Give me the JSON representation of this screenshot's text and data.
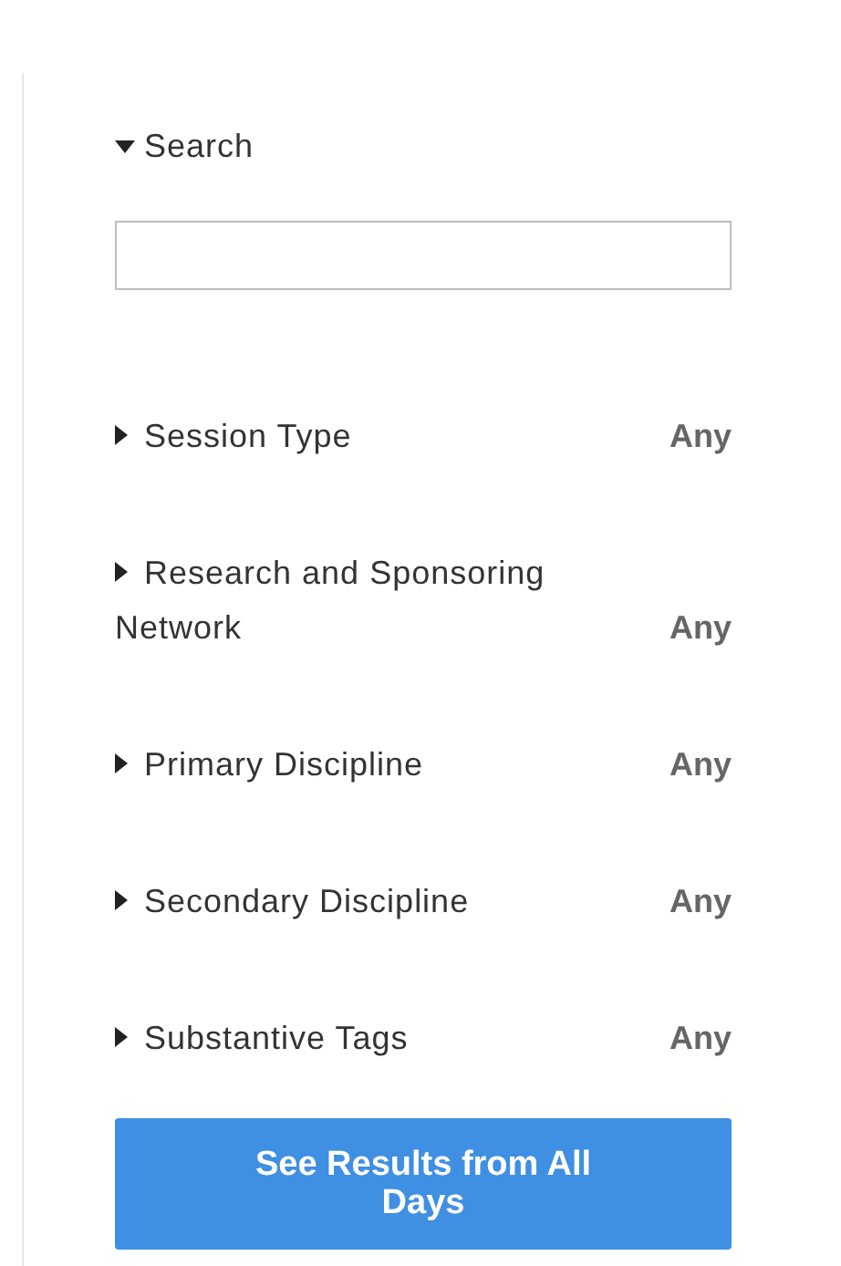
{
  "search": {
    "label": "Search",
    "expanded": true
  },
  "filters": [
    {
      "label": "Session Type",
      "value": "Any",
      "expanded": false
    },
    {
      "label": "Research and Sponsoring Network",
      "value": "Any",
      "expanded": false
    },
    {
      "label": "Primary Discipline",
      "value": "Any",
      "expanded": false
    },
    {
      "label": "Secondary Discipline",
      "value": "Any",
      "expanded": false
    },
    {
      "label": "Substantive Tags",
      "value": "Any",
      "expanded": false
    }
  ],
  "button": {
    "label": "See Results from All Days"
  }
}
